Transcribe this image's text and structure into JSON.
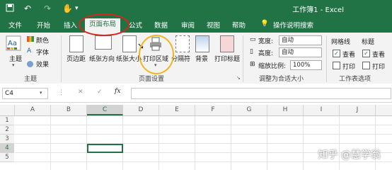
{
  "window": {
    "title": "工作簿1 - Excel"
  },
  "tabs": [
    "文件",
    "开始",
    "插入",
    "页面布局",
    "公式",
    "数据",
    "审阅",
    "视图",
    "帮助"
  ],
  "active_tab": "页面布局",
  "tell_me": "操作说明搜索",
  "ribbon": {
    "themes": {
      "label": "主题",
      "colors": "颜色",
      "fonts": "字体",
      "effects": "效果",
      "group": "主题"
    },
    "page_setup": {
      "margins": "页边距",
      "orientation": "纸张方向",
      "size": "纸张大小",
      "print_area": "打印区域",
      "breaks": "分隔符",
      "background": "背景",
      "print_titles": "打印标题",
      "group": "页面设置"
    },
    "scale": {
      "width_label": "宽度:",
      "width_value": "自动",
      "height_label": "高度:",
      "height_value": "自动",
      "scale_label": "缩放比例:",
      "scale_value": "100%",
      "group": "调整为合适大小"
    },
    "sheet_options": {
      "gridlines": "网格线",
      "headings": "标题",
      "view": "查看",
      "print": "打印",
      "group": "工作表选项"
    }
  },
  "formula_bar": {
    "name_box": "C4",
    "fx": "fx",
    "cancel": "✕",
    "enter": "✓",
    "value": ""
  },
  "columns": [
    "A",
    "B",
    "C",
    "D",
    "E",
    "F",
    "G",
    "H",
    "I",
    "J"
  ],
  "rows": [
    "1",
    "2",
    "3",
    "4",
    "5"
  ],
  "selected_cell": "C4",
  "watermark": "知乎 @慧学翁",
  "colors": {
    "brand": "#217346",
    "highlight_red": "#d8251d",
    "highlight_yellow": "#f3b51d"
  }
}
